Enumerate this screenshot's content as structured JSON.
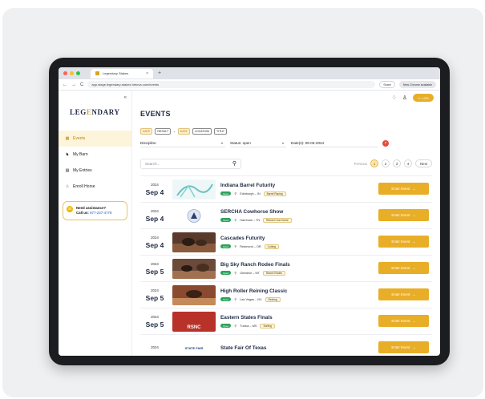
{
  "browser": {
    "tab_title": "Legendary Stakes",
    "tab_close": "×",
    "new_tab": "+",
    "url": "app.stage.legendary-stakes.hetova.com/events",
    "share_label": "Share",
    "chrome_label": "New Chrome available",
    "back": "←",
    "forward": "→",
    "reload": "C"
  },
  "sidebar": {
    "logo_prefix": "LEG",
    "logo_accent": "E",
    "logo_suffix": "NDARY",
    "collapse": "«",
    "items": [
      {
        "label": "Events",
        "icon": "calendar-icon",
        "glyph": "▦",
        "active": true
      },
      {
        "label": "My Barn",
        "icon": "horse-icon",
        "glyph": "♞",
        "active": false
      },
      {
        "label": "My Entries",
        "icon": "list-icon",
        "glyph": "▤",
        "active": false
      },
      {
        "label": "Enroll Horse",
        "icon": "horse-head-icon",
        "glyph": "♘",
        "active": false
      }
    ],
    "assist": {
      "title": "Need assistance?",
      "call": "Call us:",
      "phone": "877-227-4778",
      "icon_glyph": "☏"
    }
  },
  "header": {
    "title": "EVENTS",
    "bell_glyph": "♢",
    "user_glyph": "♙",
    "login_label": "LOG",
    "login_glyph": "↪"
  },
  "filters": {
    "chips": [
      {
        "label": "DATE",
        "style": "gold"
      },
      {
        "label": "RESULT",
        "style": "plain"
      },
      {
        "label": "+",
        "style": "sep"
      },
      {
        "label": "DATE",
        "style": "gold"
      },
      {
        "label": "LOCATION",
        "style": "plain"
      },
      {
        "label": "TITLE",
        "style": "plain"
      }
    ],
    "discipline": "Discipline",
    "status": "Status: open",
    "dates": "Date(s): 09-03-2024",
    "clear_glyph": "×",
    "caret": "▾"
  },
  "search": {
    "placeholder": "Search...",
    "icon_glyph": "⚲"
  },
  "pager": {
    "previous": "Previous",
    "pages": [
      "1",
      "2",
      "3",
      "4"
    ],
    "current": "1",
    "next": "Next"
  },
  "events": [
    {
      "year": "2024",
      "md": "Sep 4",
      "name": "Indiana Barrel Futurity",
      "status": "Open",
      "location": "Edinburgh – IN",
      "tag": "Barrel Racing",
      "thumb": "logo-iby",
      "enter": "Enter Event"
    },
    {
      "year": "2024",
      "md": "Sep 4",
      "name": "SERCHA Cowhorse Show",
      "status": "Open",
      "location": "Harriman – TN",
      "tag": "Reined Cow Horse",
      "thumb": "logo-sercha",
      "enter": "Enter Event"
    },
    {
      "year": "2024",
      "md": "Sep 4",
      "name": "Cascades Futurity",
      "status": "Open",
      "location": "Redmond – OR",
      "tag": "Cutting",
      "thumb": "photo-cutting",
      "enter": "Enter Event"
    },
    {
      "year": "2024",
      "md": "Sep 5",
      "name": "Big Sky Ranch Rodeo Finals",
      "status": "Open",
      "location": "Glendive – MT",
      "tag": "Ranch Rodeo",
      "thumb": "photo-rodeo",
      "enter": "Enter Event"
    },
    {
      "year": "2024",
      "md": "Sep 5",
      "name": "High Roller Reining Classic",
      "status": "Open",
      "location": "Las Vegas – NV",
      "tag": "Reining",
      "thumb": "photo-reining",
      "enter": "Enter Event"
    },
    {
      "year": "2024",
      "md": "Sep 5",
      "name": "Eastern States Finals",
      "status": "Open",
      "location": "Tunica – MS",
      "tag": "Sorting",
      "thumb": "logo-esnc",
      "enter": "Enter Event"
    },
    {
      "year": "2024",
      "md": "",
      "name": "State Fair Of Texas",
      "status": "",
      "location": "",
      "tag": "",
      "thumb": "logo-sft",
      "enter": "Enter Event"
    }
  ],
  "thumb_texts": {
    "esnc": "RSNC",
    "sft": "STATE FAIR",
    "arrow": "→"
  },
  "colors": {
    "accent": "#e9ae28",
    "navy": "#1f2a44",
    "open": "#2aa35a",
    "danger": "#e44a3b"
  }
}
